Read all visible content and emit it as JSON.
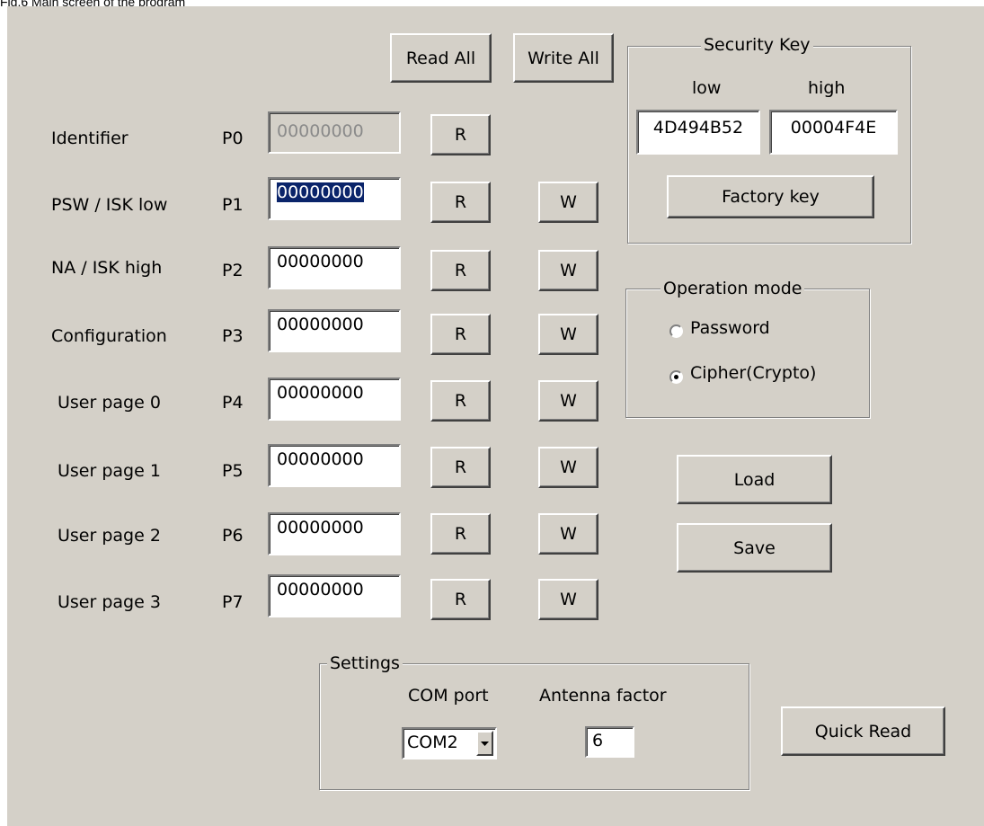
{
  "caption": "Fig.6 Main screen of the program",
  "toolbar": {
    "read_all": "Read All",
    "write_all": "Write All"
  },
  "pages": [
    {
      "name": "Identifier",
      "id": "P0",
      "value": "00000000",
      "read": "R",
      "write": ""
    },
    {
      "name": "PSW / ISK low",
      "id": "P1",
      "value": "00000000",
      "read": "R",
      "write": "W"
    },
    {
      "name": "NA / ISK high",
      "id": "P2",
      "value": "00000000",
      "read": "R",
      "write": "W"
    },
    {
      "name": "Configuration",
      "id": "P3",
      "value": "00000000",
      "read": "R",
      "write": "W"
    },
    {
      "name": "User page 0",
      "id": "P4",
      "value": "00000000",
      "read": "R",
      "write": "W"
    },
    {
      "name": "User page 1",
      "id": "P5",
      "value": "00000000",
      "read": "R",
      "write": "W"
    },
    {
      "name": "User page 2",
      "id": "P6",
      "value": "00000000",
      "read": "R",
      "write": "W"
    },
    {
      "name": "User page 3",
      "id": "P7",
      "value": "00000000",
      "read": "R",
      "write": "W"
    }
  ],
  "security_key": {
    "title": "Security Key",
    "low_label": "low",
    "high_label": "high",
    "low_value": "4D494B52",
    "high_value": "00004F4E",
    "factory_button": "Factory key"
  },
  "operation_mode": {
    "title": "Operation mode",
    "options": [
      {
        "label": "Password",
        "selected": false
      },
      {
        "label": "Cipher(Crypto)",
        "selected": true
      }
    ]
  },
  "file_buttons": {
    "load": "Load",
    "save": "Save"
  },
  "settings": {
    "title": "Settings",
    "com_port_label": "COM port",
    "com_port_value": "COM2",
    "antenna_label": "Antenna factor",
    "antenna_value": "6"
  },
  "quick_read": "Quick Read"
}
